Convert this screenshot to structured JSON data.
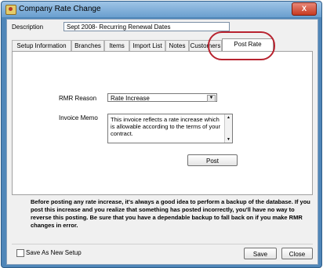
{
  "window": {
    "title": "Company Rate Change",
    "close_glyph": "X"
  },
  "description": {
    "label": "Description",
    "value": "Sept 2008- Recurring Renewal Dates"
  },
  "tabs": [
    {
      "label": "Setup Information"
    },
    {
      "label": "Branches"
    },
    {
      "label": "Items"
    },
    {
      "label": "Import List"
    },
    {
      "label": "Notes"
    },
    {
      "label": "Customers"
    },
    {
      "label": "Post Rate Change",
      "active": true
    }
  ],
  "post_rate_change": {
    "rmr_reason_label": "RMR Reason",
    "rmr_reason_value": "Rate Increase",
    "invoice_memo_label": "Invoice Memo",
    "invoice_memo_value": "This invoice reflects a rate increase which is allowable according to the terms of your contract.",
    "post_button": "Post"
  },
  "note": "Before posting any rate increase, it's always a good idea to perform a backup of the database.  If you post this increase and you realize that something has posted incorrectly, you'll have no way to reverse this posting.  Be sure that you have a dependable backup to fall back on if you make RMR changes in error.",
  "footer": {
    "save_as_new_label": "Save As New Setup",
    "save_button": "Save",
    "close_button": "Close"
  },
  "colors": {
    "highlight_oval": "#b8232f",
    "titlebar": "#6a9fcf"
  }
}
